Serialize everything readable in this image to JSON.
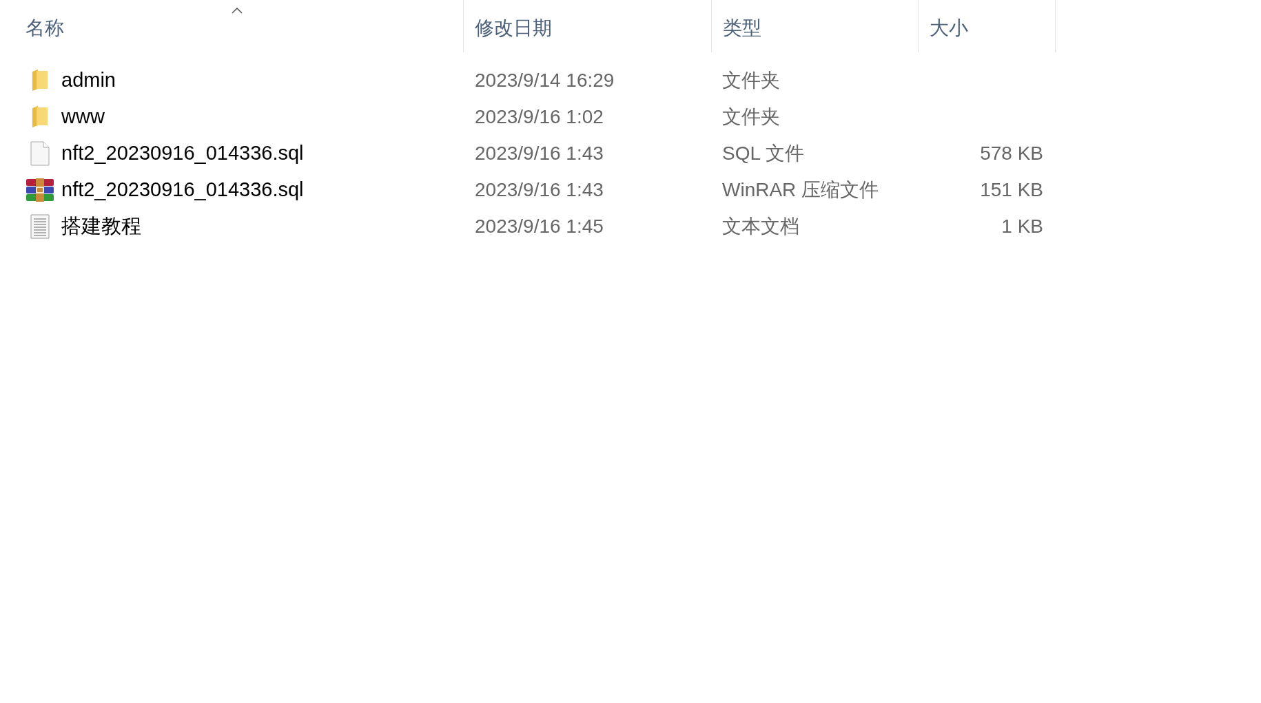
{
  "columns": [
    {
      "label": "名称",
      "sorted": true
    },
    {
      "label": "修改日期",
      "sorted": false
    },
    {
      "label": "类型",
      "sorted": false
    },
    {
      "label": "大小",
      "sorted": false
    }
  ],
  "rows": [
    {
      "kind": "folder",
      "name": "admin",
      "date": "2023/9/14 16:29",
      "type": "文件夹"
    },
    {
      "kind": "folder",
      "name": "www",
      "date": "2023/9/16 1:02",
      "type": "文件夹"
    },
    {
      "kind": "file",
      "name": "nft2_20230916_014336.sql",
      "date": "2023/9/16 1:43",
      "type": "SQL 文件",
      "size": "578 KB"
    },
    {
      "kind": "archive",
      "name": "nft2_20230916_014336.sql",
      "date": "2023/9/16 1:43",
      "type": "WinRAR 压缩文件",
      "size": "151 KB"
    },
    {
      "kind": "text",
      "name": "搭建教程",
      "date": "2023/9/16 1:45",
      "type": "文本文档",
      "size": "1 KB"
    }
  ]
}
